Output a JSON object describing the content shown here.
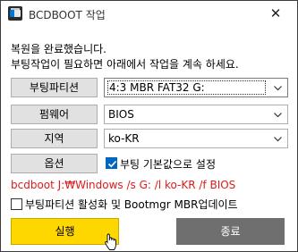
{
  "window": {
    "title": "BCDBOOT 작업",
    "close_glyph": "✕"
  },
  "message": {
    "line1": "복원을 완료했습니다.",
    "line2": "부팅작업이 필요하면 아래에서 작업을 계속 하세요."
  },
  "rows": {
    "partition": {
      "label": "부팅파티션",
      "value": "4:3 MBR FAT32 G:"
    },
    "firmware": {
      "label": "펌웨어",
      "value": "BIOS"
    },
    "locale": {
      "label": "지역",
      "value": "ko-KR"
    },
    "options": {
      "label": "옵션",
      "checkbox_label": "부팅 기본값으로 설정",
      "checked": true
    }
  },
  "command": "bcdboot J:₩Windows /s G: /l ko-KR /f BIOS",
  "activate": {
    "label": "부팅파티션 활성화 및 Bootmgr MBR업데이트",
    "checked": false
  },
  "actions": {
    "run_label": "실행",
    "close_label": "종료"
  },
  "colors": {
    "run_button": "#ffd700",
    "close_button": "#6f6f6f",
    "command_text": "#e01a1a",
    "checkbox_checked": "#0067c0"
  }
}
